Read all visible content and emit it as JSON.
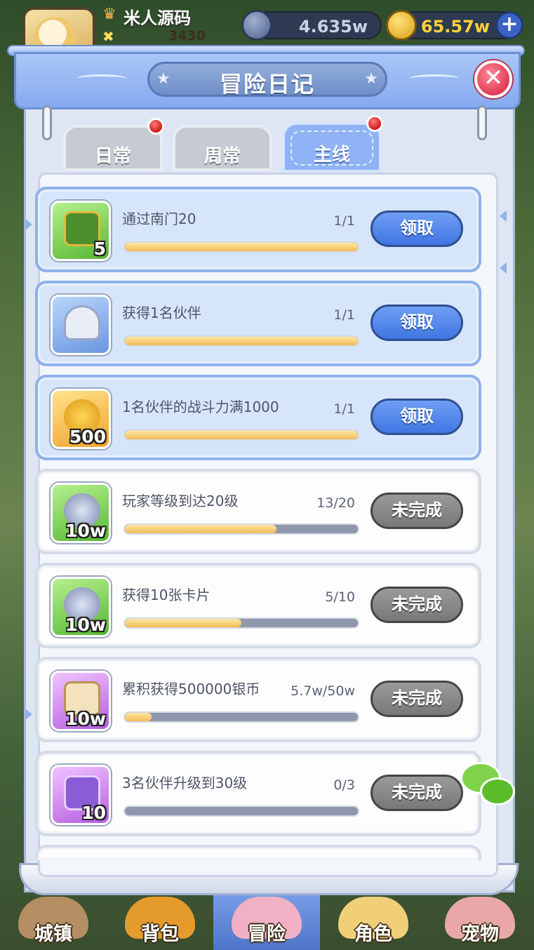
{
  "hud": {
    "player_name": "米人源码",
    "power": "3430",
    "currency_silver": "4.635w",
    "currency_gold": "65.57w",
    "colors": {
      "silver_text": "#c9d3e3",
      "gold_text": "#ffd23a"
    }
  },
  "panel": {
    "title": "冒险日记"
  },
  "tabs": [
    {
      "label": "日常",
      "badge": true,
      "active": false
    },
    {
      "label": "周常",
      "badge": false,
      "active": false
    },
    {
      "label": "主线",
      "badge": true,
      "active": true
    }
  ],
  "tasks": [
    {
      "name": "通过南门20",
      "progress": "1/1",
      "fill": 1.0,
      "button": "领取",
      "state": "claimable",
      "reward_qty": "5",
      "icon": "green-chest-icon"
    },
    {
      "name": "获得1名伙伴",
      "progress": "1/1",
      "fill": 1.0,
      "button": "领取",
      "state": "claimable",
      "reward_qty": "",
      "icon": "viking-helmet-icon"
    },
    {
      "name": "1名伙伴的战斗力满1000",
      "progress": "1/1",
      "fill": 1.0,
      "button": "领取",
      "state": "claimable",
      "reward_qty": "500",
      "icon": "gold-coins-icon"
    },
    {
      "name": "玩家等级到达20级",
      "progress": "13/20",
      "fill": 0.65,
      "button": "未完成",
      "state": "incomplete",
      "reward_qty": "10w",
      "icon": "silver-coins-icon"
    },
    {
      "name": "获得10张卡片",
      "progress": "5/10",
      "fill": 0.5,
      "button": "未完成",
      "state": "incomplete",
      "reward_qty": "10w",
      "icon": "silver-coins-icon"
    },
    {
      "name": "累积获得500000银币",
      "progress": "5.7w/50w",
      "fill": 0.114,
      "button": "未完成",
      "state": "incomplete",
      "reward_qty": "10w",
      "icon": "scroll-icon"
    },
    {
      "name": "3名伙伴升级到30级",
      "progress": "0/3",
      "fill": 0.0,
      "button": "未完成",
      "state": "incomplete",
      "reward_qty": "10",
      "icon": "purple-book-icon"
    }
  ],
  "bottom_nav": [
    {
      "label": "城镇",
      "active": false
    },
    {
      "label": "背包",
      "active": false
    },
    {
      "label": "冒险",
      "active": true
    },
    {
      "label": "角色",
      "active": false
    },
    {
      "label": "宠物",
      "active": false
    }
  ]
}
